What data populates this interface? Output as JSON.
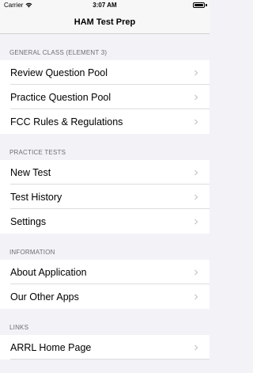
{
  "status_bar": {
    "carrier": "Carrier",
    "time": "3:07 AM"
  },
  "nav": {
    "title": "HAM Test Prep"
  },
  "sections": [
    {
      "header": "GENERAL CLASS (ELEMENT 3)",
      "items": [
        "Review Question Pool",
        "Practice Question Pool",
        "FCC Rules & Regulations"
      ]
    },
    {
      "header": "PRACTICE TESTS",
      "items": [
        "New Test",
        "Test History",
        "Settings"
      ]
    },
    {
      "header": "INFORMATION",
      "items": [
        "About Application",
        "Our Other Apps"
      ]
    },
    {
      "header": "LINKS",
      "items": [
        "ARRL Home Page"
      ]
    }
  ],
  "colors": {
    "background": "#f2f2f7",
    "header_text": "#6d6d72",
    "chevron": "#c4c4c7"
  }
}
